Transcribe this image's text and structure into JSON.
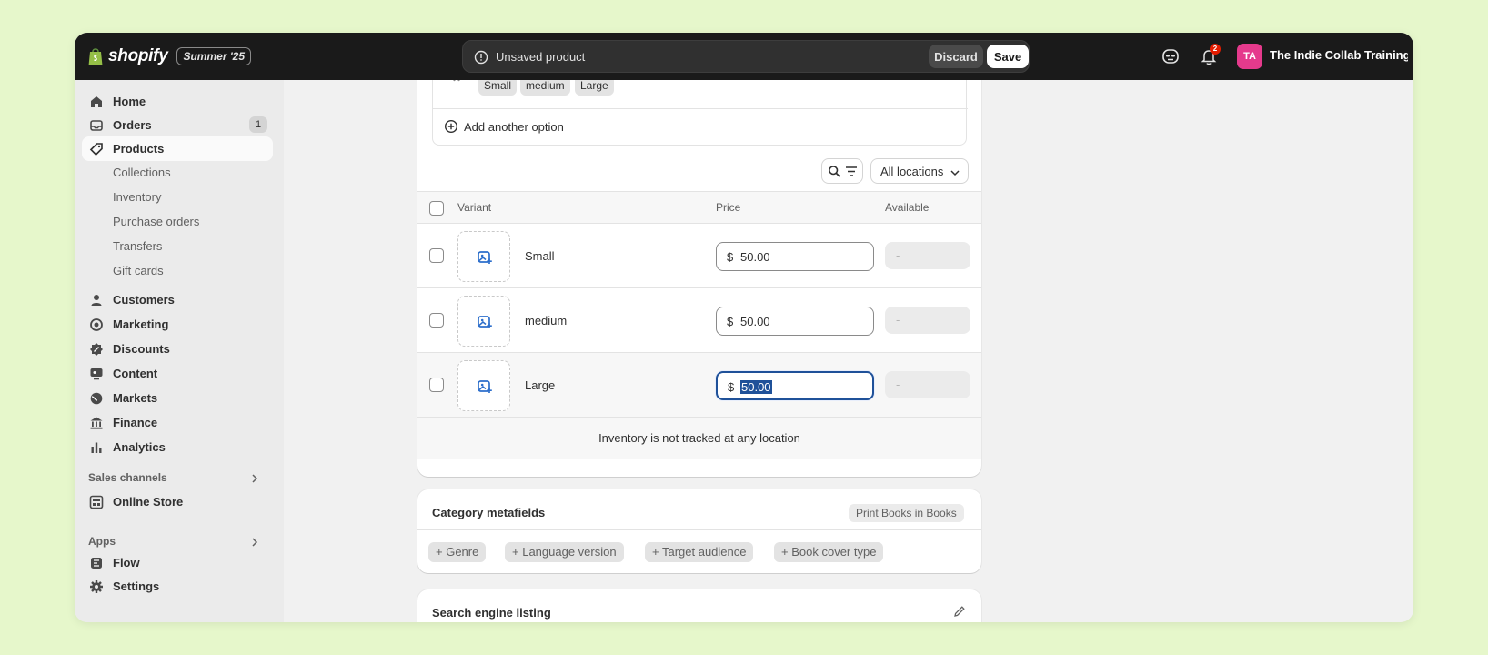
{
  "topbar": {
    "brand": "shopify",
    "edition": "Summer '25",
    "unsaved_message": "Unsaved product",
    "discard_label": "Discard",
    "save_label": "Save",
    "notification_count": "2",
    "avatar_initials": "TA",
    "store_name": "The Indie Collab Training ..."
  },
  "sidebar": {
    "items": [
      {
        "label": "Home",
        "icon": "home-icon"
      },
      {
        "label": "Orders",
        "icon": "inbox-icon",
        "count": "1"
      },
      {
        "label": "Products",
        "icon": "tag-icon"
      },
      {
        "label": "Customers",
        "icon": "person-icon"
      },
      {
        "label": "Marketing",
        "icon": "target-icon"
      },
      {
        "label": "Discounts",
        "icon": "discount-icon"
      },
      {
        "label": "Content",
        "icon": "content-icon"
      },
      {
        "label": "Markets",
        "icon": "globe-icon"
      },
      {
        "label": "Finance",
        "icon": "bank-icon"
      },
      {
        "label": "Analytics",
        "icon": "bar-chart-icon"
      }
    ],
    "product_subitems": [
      "Collections",
      "Inventory",
      "Purchase orders",
      "Transfers",
      "Gift cards"
    ],
    "sales_channels_label": "Sales channels",
    "online_store_label": "Online Store",
    "apps_label": "Apps",
    "flow_label": "Flow",
    "settings_label": "Settings"
  },
  "options": {
    "option_values": [
      "Small",
      "medium",
      "Large"
    ],
    "add_option_label": "Add another option"
  },
  "variants": {
    "location_filter": "All locations",
    "columns": {
      "variant": "Variant",
      "price": "Price",
      "available": "Available"
    },
    "rows": [
      {
        "name": "Small",
        "currency": "$",
        "price": "50.00",
        "available": "-"
      },
      {
        "name": "medium",
        "currency": "$",
        "price": "50.00",
        "available": "-"
      },
      {
        "name": "Large",
        "currency": "$",
        "price": "50.00",
        "available": "-"
      }
    ],
    "inventory_note": "Inventory is not tracked at any location"
  },
  "category": {
    "title": "Category metafields",
    "badge": "Print Books in Books",
    "chips": [
      "Genre",
      "Language version",
      "Target audience",
      "Book cover type"
    ]
  },
  "seo": {
    "title": "Search engine listing"
  },
  "colors": {
    "topbar": "#1a1a1a",
    "background": "#e6f7cb",
    "focus": "#1f5199",
    "avatar": "#e53a8c"
  }
}
